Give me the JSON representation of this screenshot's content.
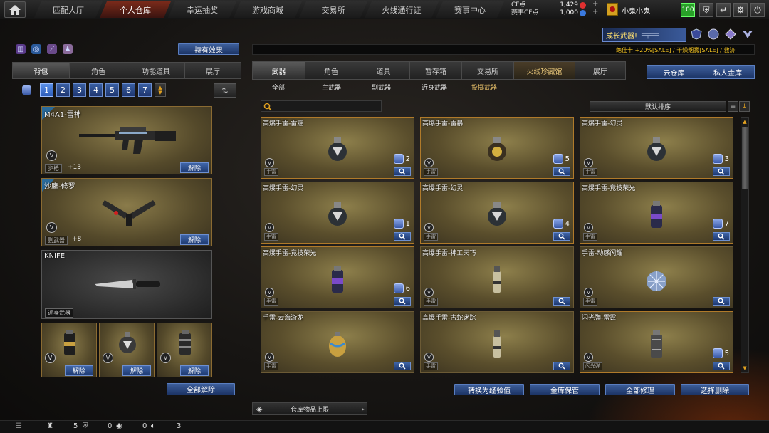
{
  "nav": {
    "tabs": [
      "匹配大厅",
      "个人仓库",
      "幸运抽奖",
      "游戏商城",
      "交易所",
      "火线通行证",
      "赛事中心"
    ],
    "active": "个人仓库"
  },
  "currency": {
    "cf_label": "CF点",
    "cf_value": "1,429",
    "match_label": "赛事CF点",
    "match_value": "1,000"
  },
  "user": {
    "name": "小鬼小鬼",
    "level": "100"
  },
  "left": {
    "effect_button": "持有效果",
    "tabs": [
      "背包",
      "角色",
      "功能道具",
      "展厅"
    ],
    "pages": [
      "1",
      "2",
      "3",
      "4",
      "5",
      "6",
      "7"
    ],
    "unequip_all": "全部解除",
    "slots": [
      {
        "name": "M4A1-雷神",
        "tag": "步枪",
        "plus": "+13",
        "button": "解除"
      },
      {
        "name": "沙鹰-修罗",
        "tag": "副武器",
        "plus": "+8",
        "button": "解除"
      },
      {
        "name": "KNIFE",
        "tag": "近身武器"
      }
    ],
    "small_button": "解除"
  },
  "right": {
    "promo": "成长武器!",
    "ticker": "绝佳卡 +20%[SALE] / 干燥烟雾[SALE] / 救济",
    "tabs": [
      "武器",
      "角色",
      "道具",
      "暂存箱",
      "交易所",
      "火线珍藏馆",
      "展厅"
    ],
    "storage_tabs": [
      "云仓库",
      "私人金库"
    ],
    "subtabs": [
      "全部",
      "主武器",
      "副武器",
      "近身武器",
      "投掷武器"
    ],
    "active_subtab": "投掷武器",
    "sort": "默认排序",
    "items": [
      {
        "name": "高爆手雷-雷霆",
        "count": "2",
        "tag": "手雷",
        "kind": "frag"
      },
      {
        "name": "高爆手雷-雷暴",
        "count": "5",
        "tag": "手雷",
        "kind": "gold"
      },
      {
        "name": "高爆手雷-幻灵",
        "count": "3",
        "tag": "手雷",
        "kind": "frag"
      },
      {
        "name": "高爆手雷-幻灵",
        "count": "1",
        "tag": "手雷",
        "kind": "frag"
      },
      {
        "name": "高爆手雷-幻灵",
        "count": "4",
        "tag": "手雷",
        "kind": "frag"
      },
      {
        "name": "高爆手雷-竞技荣光",
        "count": "7",
        "tag": "手雷",
        "kind": "can"
      },
      {
        "name": "高爆手雷-竞技荣光",
        "count": "6",
        "tag": "手雷",
        "kind": "can"
      },
      {
        "name": "高爆手雷-神工天巧",
        "count": "",
        "tag": "手雷",
        "kind": "stick"
      },
      {
        "name": "手雷-动感闪耀",
        "count": "",
        "tag": "手雷",
        "kind": "disco"
      },
      {
        "name": "手雷-云海游龙",
        "count": "",
        "tag": "手雷",
        "kind": "egg"
      },
      {
        "name": "高爆手雷-古蛇迷踪",
        "count": "",
        "tag": "手雷",
        "kind": "stick"
      },
      {
        "name": "闪光弹-雷霆",
        "count": "5",
        "tag": "闪光弹",
        "kind": "flash"
      }
    ],
    "actions": [
      "转换为经验值",
      "金库保管",
      "全部修理",
      "选择删除"
    ],
    "warehouse": "仓库物品上限"
  },
  "bottom": {
    "a": "5",
    "b": "0",
    "c": "0",
    "d": "3"
  },
  "colors": {
    "accent": "#2d5cb8",
    "gold_border": "#b07a2a",
    "active_nav": "#7a2a1a"
  }
}
